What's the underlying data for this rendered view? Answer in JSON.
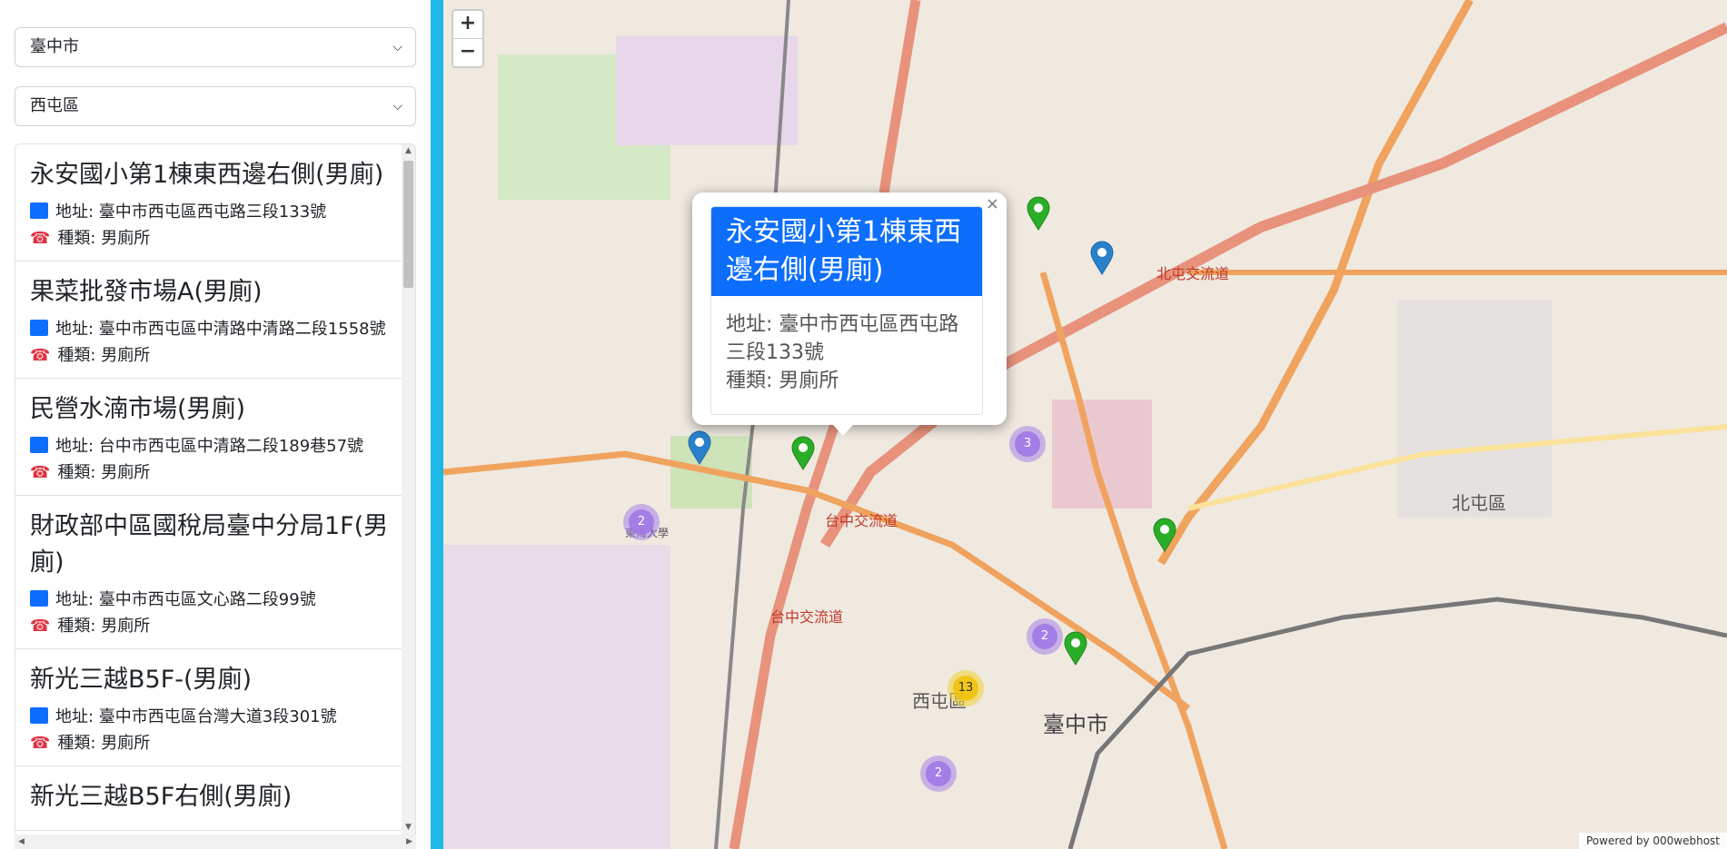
{
  "filters": {
    "city": "臺中市",
    "district": "西屯區"
  },
  "labels": {
    "address_prefix": "地址: ",
    "type_prefix": "種類: "
  },
  "list": [
    {
      "name": "永安國小第1棟東西邊右側(男廁)",
      "address": "臺中市西屯區西屯路三段133號",
      "type": "男廁所"
    },
    {
      "name": "果菜批發市場A(男廁)",
      "address": "臺中市西屯區中清路中清路二段1558號",
      "type": "男廁所"
    },
    {
      "name": "民營水湳市場(男廁)",
      "address": "台中市西屯區中清路二段189巷57號",
      "type": "男廁所"
    },
    {
      "name": "財政部中區國稅局臺中分局1F(男廁)",
      "address": "臺中市西屯區文心路二段99號",
      "type": "男廁所"
    },
    {
      "name": "新光三越B5F-(男廁)",
      "address": "臺中市西屯區台灣大道3段301號",
      "type": "男廁所"
    },
    {
      "name": "新光三越B5F右側(男廁)",
      "address": "",
      "type": ""
    }
  ],
  "map": {
    "zoom_in": "+",
    "zoom_out": "−",
    "popup": {
      "title": "永安國小第1棟東西邊右側(男廁)",
      "address": "地址: 臺中市西屯區西屯路三段133號",
      "type": "種類: 男廁所",
      "close": "×"
    },
    "clusters": [
      "3",
      "2",
      "2",
      "13",
      "2"
    ],
    "places": {
      "taichung": "臺中市",
      "xitun": "西屯區",
      "beitun": "北屯區",
      "interchange_a": "台中交流道",
      "interchange_b": "台中交流道",
      "beitun_ic": "北屯交流道",
      "tunghai": "東海大學"
    },
    "attribution": "Powered by 000webhost"
  },
  "colors": {
    "primary": "#0d6efd",
    "map_border": "#1eb8e6",
    "pin_blue": "#2a81cb",
    "pin_green": "#2aad27"
  }
}
